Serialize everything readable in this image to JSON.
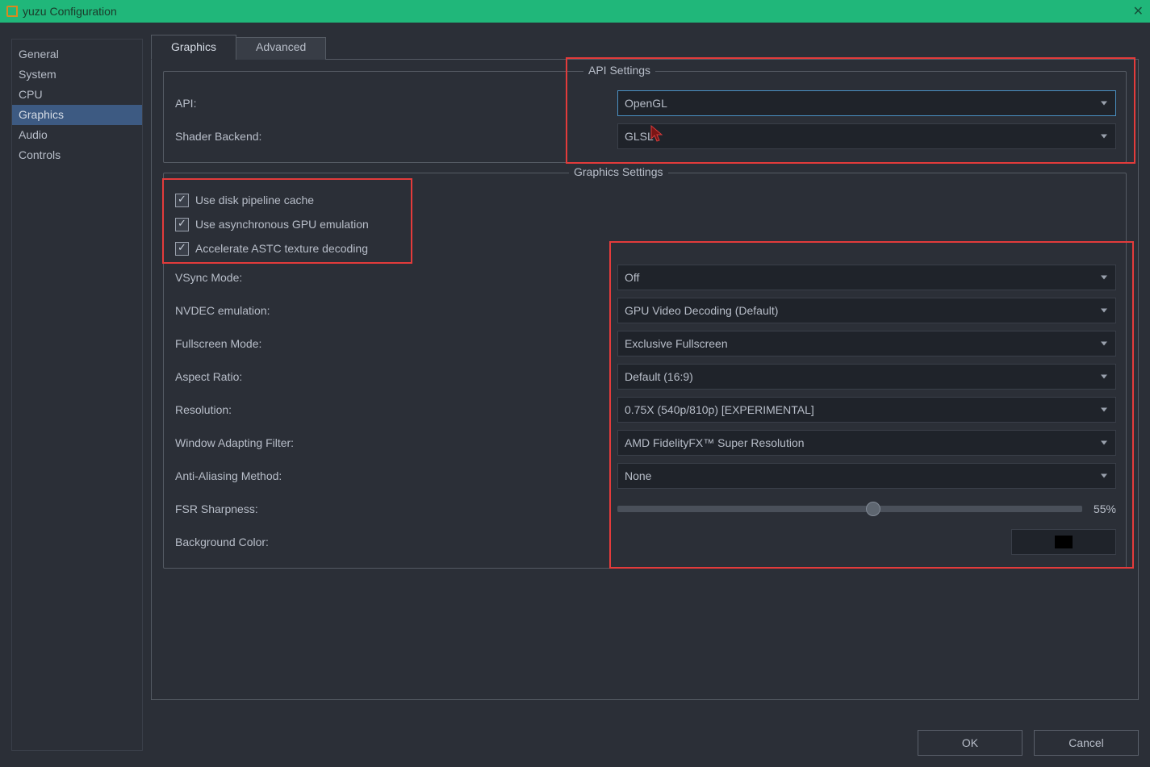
{
  "window": {
    "title": "yuzu Configuration",
    "close_glyph": "✕"
  },
  "sidebar": {
    "items": [
      {
        "label": "General",
        "selected": false
      },
      {
        "label": "System",
        "selected": false
      },
      {
        "label": "CPU",
        "selected": false
      },
      {
        "label": "Graphics",
        "selected": true
      },
      {
        "label": "Audio",
        "selected": false
      },
      {
        "label": "Controls",
        "selected": false
      }
    ]
  },
  "tabs": {
    "items": [
      {
        "label": "Graphics",
        "active": true
      },
      {
        "label": "Advanced",
        "active": false
      }
    ]
  },
  "api_group": {
    "legend": "API Settings",
    "api_label": "API:",
    "api_value": "OpenGL",
    "shader_label": "Shader Backend:",
    "shader_value": "GLSL"
  },
  "gfx_group": {
    "legend": "Graphics Settings",
    "checks": [
      {
        "label": "Use disk pipeline cache",
        "checked": true
      },
      {
        "label": "Use asynchronous GPU emulation",
        "checked": true
      },
      {
        "label": "Accelerate ASTC texture decoding",
        "checked": true
      }
    ],
    "rows": [
      {
        "id": "vsync",
        "label": "VSync Mode:",
        "value": "Off"
      },
      {
        "id": "nvdec",
        "label": "NVDEC emulation:",
        "value": "GPU Video Decoding (Default)"
      },
      {
        "id": "fullscreen",
        "label": "Fullscreen Mode:",
        "value": "Exclusive Fullscreen"
      },
      {
        "id": "aspect",
        "label": "Aspect Ratio:",
        "value": "Default (16:9)"
      },
      {
        "id": "resolution",
        "label": "Resolution:",
        "value": "0.75X (540p/810p) [EXPERIMENTAL]"
      },
      {
        "id": "filter",
        "label": "Window Adapting Filter:",
        "value": "AMD FidelityFX™ Super Resolution"
      },
      {
        "id": "aa",
        "label": "Anti-Aliasing Method:",
        "value": "None"
      }
    ],
    "fsr_label": "FSR Sharpness:",
    "fsr_percent_text": "55%",
    "fsr_percent_value": 55,
    "bg_label": "Background Color:",
    "bg_color": "#000000"
  },
  "footer": {
    "ok": "OK",
    "cancel": "Cancel"
  }
}
